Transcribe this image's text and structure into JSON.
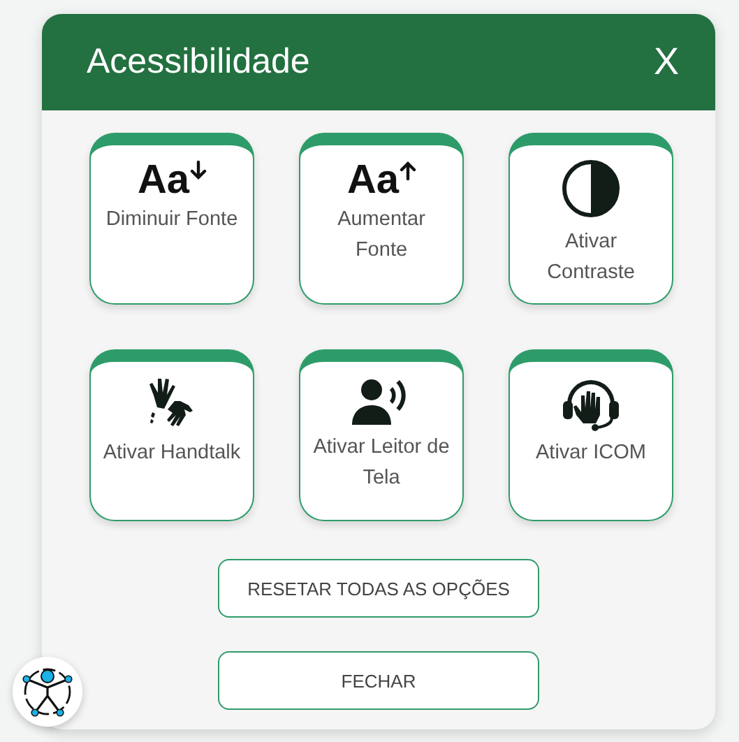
{
  "panel": {
    "title": "Acessibilidade",
    "close": "X"
  },
  "options": [
    {
      "kind": "font_down",
      "glyph": "Aa",
      "label": "Diminuir Fonte"
    },
    {
      "kind": "font_up",
      "glyph": "Aa",
      "label": "Aumentar Fonte"
    },
    {
      "kind": "contrast",
      "label": "Ativar Contraste"
    },
    {
      "kind": "handtalk",
      "label": "Ativar Handtalk"
    },
    {
      "kind": "reader",
      "label": "Ativar Leitor de Tela"
    },
    {
      "kind": "icom",
      "label": "Ativar ICOM"
    }
  ],
  "buttons": [
    "RESETAR TODAS AS OPÇÕES",
    "FECHAR"
  ]
}
